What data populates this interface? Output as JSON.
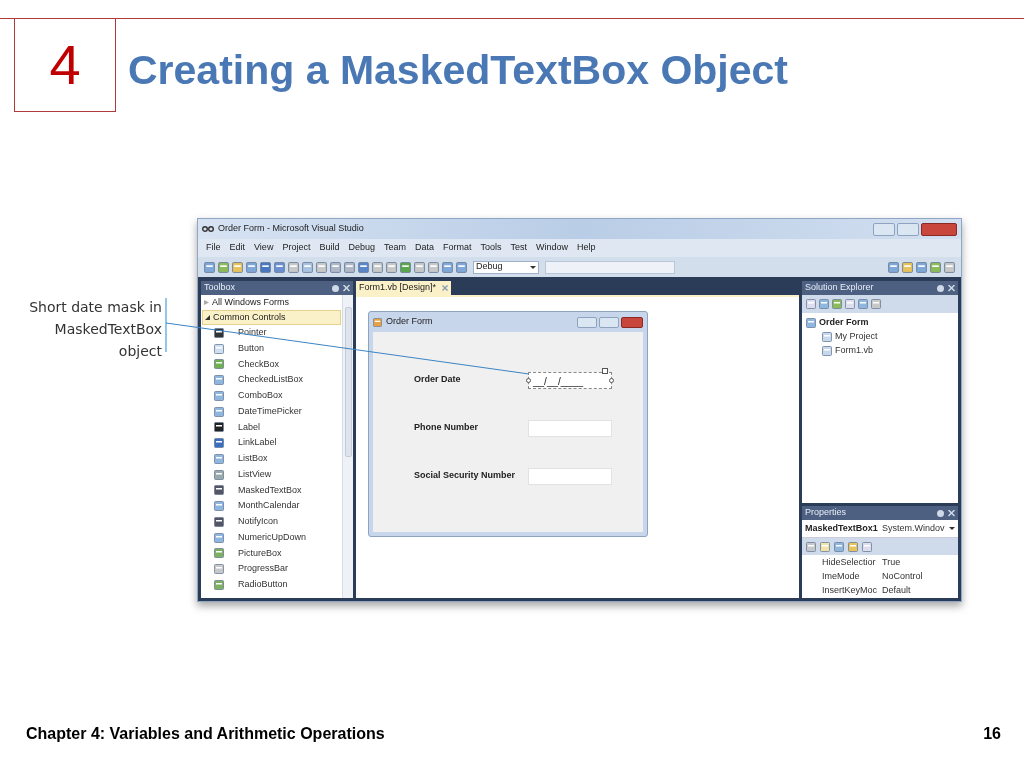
{
  "slide": {
    "number": "4",
    "title": "Creating a MaskedTextBox Object",
    "callout": "Short date mask in MaskedTextBox object",
    "footer": "Chapter 4: Variables and Arithmetic Operations",
    "page": "16"
  },
  "window": {
    "title": "Order Form - Microsoft Visual Studio"
  },
  "menu": [
    "File",
    "Edit",
    "View",
    "Project",
    "Build",
    "Debug",
    "Team",
    "Data",
    "Format",
    "Tools",
    "Test",
    "Window",
    "Help"
  ],
  "toolbar": {
    "configuration": "Debug"
  },
  "toolbox": {
    "title": "Toolbox",
    "groups": [
      {
        "label": "All Windows Forms",
        "expanded": false,
        "selected": false
      },
      {
        "label": "Common Controls",
        "expanded": true,
        "selected": true
      }
    ],
    "items": [
      "Pointer",
      "Button",
      "CheckBox",
      "CheckedListBox",
      "ComboBox",
      "DateTimePicker",
      "Label",
      "LinkLabel",
      "ListBox",
      "ListView",
      "MaskedTextBox",
      "MonthCalendar",
      "NotifyIcon",
      "NumericUpDown",
      "PictureBox",
      "ProgressBar",
      "RadioButton"
    ]
  },
  "document_tab": {
    "label": "Form1.vb [Design]*",
    "selected": true
  },
  "form": {
    "title": "Order Form",
    "fields": [
      {
        "label": "Order Date",
        "value": "__/__/____",
        "selected": true
      },
      {
        "label": "Phone Number",
        "selected": false
      },
      {
        "label": "Social Security Number",
        "selected": false
      }
    ]
  },
  "solution_explorer": {
    "title": "Solution Explorer",
    "tree": [
      {
        "label": "Order Form",
        "children": [
          {
            "label": "My Project"
          },
          {
            "label": "Form1.vb"
          }
        ]
      }
    ]
  },
  "properties": {
    "title": "Properties",
    "object": "MaskedTextBox1",
    "type": "System.Windov",
    "rows": [
      {
        "name": "HideSelectior",
        "value": "True"
      },
      {
        "name": "ImeMode",
        "value": "NoControl"
      },
      {
        "name": "InsertKeyMoc",
        "value": "Default"
      }
    ]
  }
}
